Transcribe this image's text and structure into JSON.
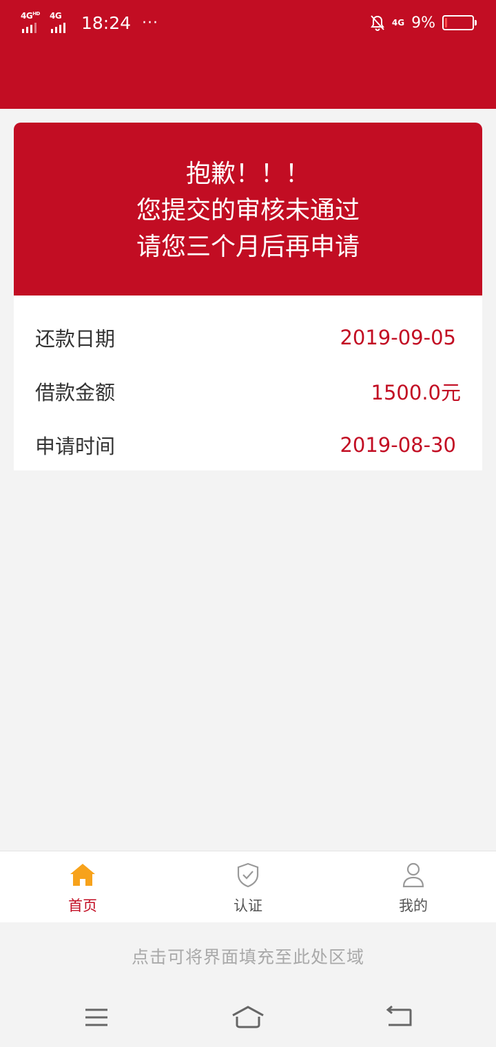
{
  "status_bar": {
    "net1": "4G",
    "net1_sup": "HD",
    "net2": "4G",
    "time": "18:24",
    "dots": "···",
    "net_right": "4G",
    "battery_text": "9%",
    "battery_level": 0.09,
    "background": "#c20d23"
  },
  "notice": {
    "line1": "抱歉！！！",
    "line2": "您提交的审核未通过",
    "line3": "请您三个月后再申请"
  },
  "details": {
    "rows": [
      {
        "label": "还款日期",
        "value": "2019-09-05"
      },
      {
        "label": "借款金额",
        "value": "1500.0元"
      },
      {
        "label": "申请时间",
        "value": "2019-08-30"
      }
    ]
  },
  "tabbar": {
    "tabs": [
      {
        "label": "首页",
        "icon": "home-icon",
        "active": true
      },
      {
        "label": "认证",
        "icon": "shield-check-icon",
        "active": false
      },
      {
        "label": "我的",
        "icon": "user-icon",
        "active": false
      }
    ]
  },
  "fill_hint": "点击可将界面填充至此处区域",
  "nav": {
    "icons": [
      "menu-icon",
      "home-nav-icon",
      "back-icon"
    ]
  },
  "colors": {
    "accent": "#c20d23",
    "home_icon": "#f7a21b",
    "background": "#f3f3f3"
  }
}
